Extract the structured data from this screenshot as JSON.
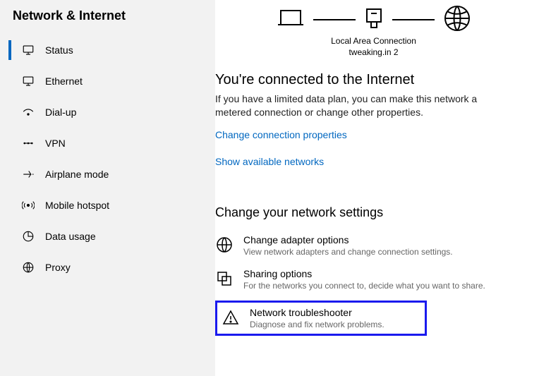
{
  "sidebar": {
    "title": "Network & Internet",
    "items": [
      {
        "label": "Status"
      },
      {
        "label": "Ethernet"
      },
      {
        "label": "Dial-up"
      },
      {
        "label": "VPN"
      },
      {
        "label": "Airplane mode"
      },
      {
        "label": "Mobile hotspot"
      },
      {
        "label": "Data usage"
      },
      {
        "label": "Proxy"
      }
    ]
  },
  "diagram": {
    "caption_line1": "Local Area Connection",
    "caption_line2": "tweaking.in 2"
  },
  "status": {
    "heading": "You're connected to the Internet",
    "body": "If you have a limited data plan, you can make this network a metered connection or change other properties.",
    "link_props": "Change connection properties",
    "link_show": "Show available networks"
  },
  "settings": {
    "heading": "Change your network settings",
    "opts": [
      {
        "title": "Change adapter options",
        "sub": "View network adapters and change connection settings."
      },
      {
        "title": "Sharing options",
        "sub": "For the networks you connect to, decide what you want to share."
      },
      {
        "title": "Network troubleshooter",
        "sub": "Diagnose and fix network problems."
      }
    ]
  }
}
